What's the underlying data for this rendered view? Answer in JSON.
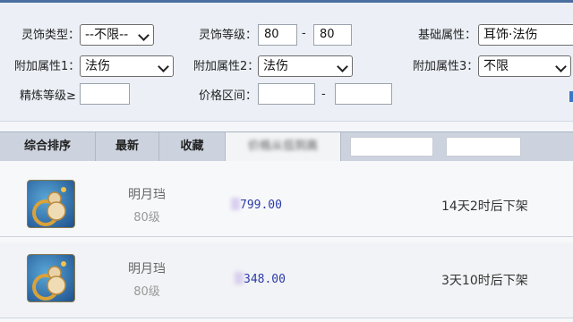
{
  "filters": {
    "type_label": "灵饰类型：",
    "type_value": "--不限--",
    "level_label": "灵饰等级：",
    "level_min": "80",
    "level_dash": "-",
    "level_max": "80",
    "base_attr_label": "基础属性：",
    "base_attr_value": "耳饰·法伤",
    "extra1_label": "附加属性1：",
    "extra1_value": "法伤",
    "extra2_label": "附加属性2：",
    "extra2_value": "法伤",
    "extra3_label": "附加属性3：",
    "extra3_value": "不限",
    "refine_label": "精炼等级≥",
    "refine_value": "",
    "price_label": "价格区间：",
    "price_min": "",
    "price_dash": "-",
    "price_max": ""
  },
  "sort_tabs": [
    {
      "label": "综合排序"
    },
    {
      "label": "最新"
    },
    {
      "label": "收藏"
    },
    {
      "label": "价格从低到高"
    }
  ],
  "listings": [
    {
      "name": "明月珰",
      "level": "80级",
      "price_masked": "799.00",
      "status": "14天2时后下架"
    },
    {
      "name": "明月珰",
      "level": "80级",
      "price_masked": "348.00",
      "status": "3天10时后下架"
    }
  ],
  "colors": {
    "accent": "#4a6ea0",
    "price": "#2b3aa8",
    "sortbar": "#cdd3de"
  }
}
